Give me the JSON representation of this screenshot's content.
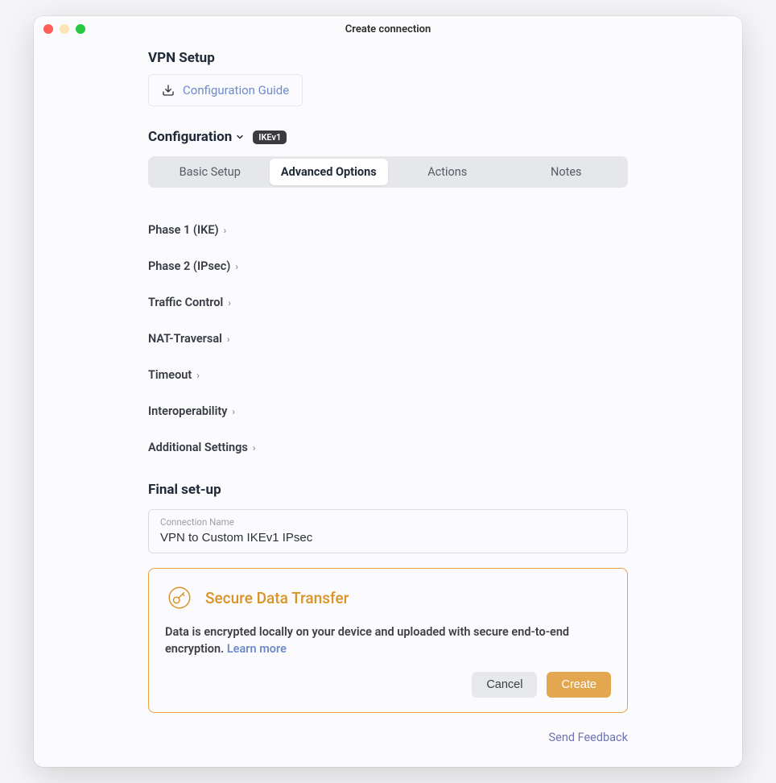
{
  "window": {
    "title": "Create connection"
  },
  "vpn": {
    "title": "VPN Setup",
    "guide_label": "Configuration Guide"
  },
  "configuration": {
    "label": "Configuration",
    "badge": "IKEv1",
    "tabs": {
      "basic": "Basic Setup",
      "advanced": "Advanced Options",
      "actions": "Actions",
      "notes": "Notes"
    },
    "expanders": {
      "phase1": "Phase 1 (IKE)",
      "phase2": "Phase 2 (IPsec)",
      "traffic": "Traffic Control",
      "nat": "NAT-Traversal",
      "timeout": "Timeout",
      "interop": "Interoperability",
      "additional": "Additional Settings"
    }
  },
  "final": {
    "title": "Final set-up",
    "conn_label": "Connection Name",
    "conn_value": "VPN to Custom IKEv1 IPsec"
  },
  "secure": {
    "title": "Secure Data Transfer",
    "text": "Data is encrypted locally on your device and uploaded with secure end-to-end encryption. ",
    "learn": "Learn more",
    "cancel": "Cancel",
    "create": "Create"
  },
  "footer": {
    "feedback": "Send Feedback"
  }
}
